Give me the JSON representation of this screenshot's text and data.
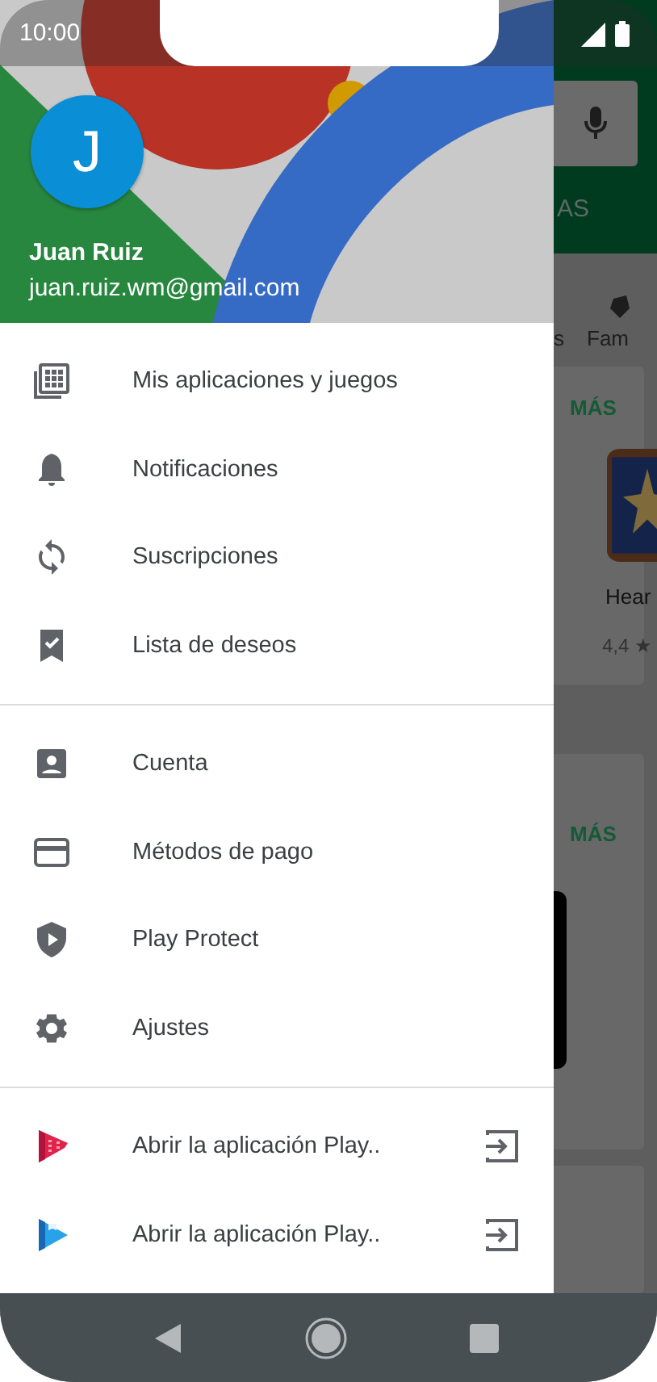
{
  "status_bar": {
    "time": "10:00"
  },
  "account": {
    "avatar_letter": "J",
    "name": "Juan Ruiz",
    "email": "juan.ruiz.wm@gmail.com"
  },
  "drawer_groups": [
    {
      "items": [
        {
          "kind": "menu",
          "label": "Mis aplicaciones y juegos"
        },
        {
          "kind": "menu",
          "label": "Notificaciones"
        },
        {
          "kind": "menu",
          "label": "Suscripciones"
        },
        {
          "kind": "menu",
          "label": "Lista de deseos"
        }
      ]
    },
    {
      "items": [
        {
          "kind": "menu",
          "label": "Cuenta"
        },
        {
          "kind": "menu",
          "label": "Métodos de pago"
        },
        {
          "kind": "menu",
          "label": "Play Protect"
        },
        {
          "kind": "menu",
          "label": "Ajustes"
        }
      ]
    },
    {
      "items": [
        {
          "kind": "app-link",
          "label": "Abrir la aplicación Play.."
        },
        {
          "kind": "app-link",
          "label": "Abrir la aplicación Play.."
        }
      ]
    }
  ],
  "background_store": {
    "tab_label": "AS",
    "category_1": "s",
    "category_2": "Fam",
    "cards": [
      {
        "more": "MÁS",
        "app_name": "Hear",
        "rating": "4,4 ★"
      },
      {
        "more": "MÁS"
      }
    ]
  }
}
